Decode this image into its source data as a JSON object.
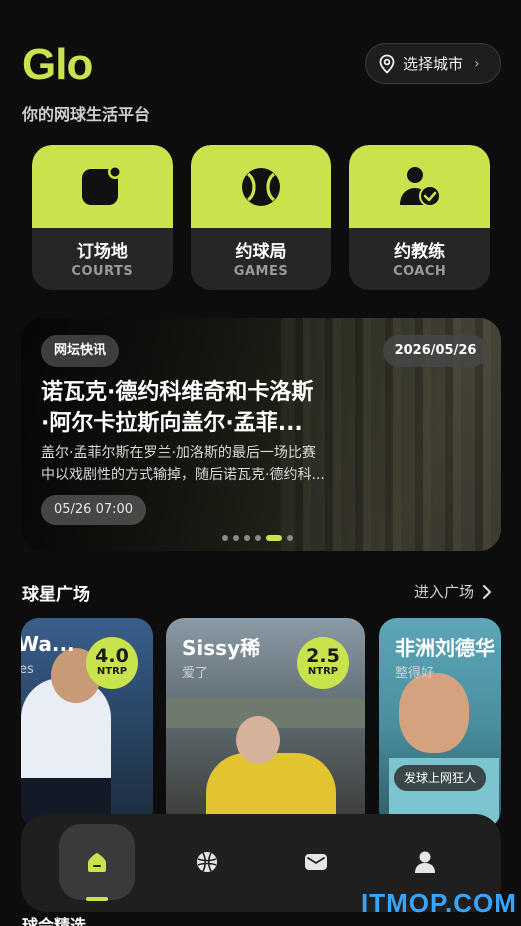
{
  "app": {
    "logo": "Glo",
    "tagline": "你的网球生活平台",
    "accent": "#c9e34c"
  },
  "city": {
    "label": "选择城市",
    "icon": "location-pin-icon"
  },
  "services": [
    {
      "cn": "订场地",
      "en": "COURTS",
      "icon": "court-icon"
    },
    {
      "cn": "约球局",
      "en": "GAMES",
      "icon": "tennis-ball-icon"
    },
    {
      "cn": "约教练",
      "en": "COACH",
      "icon": "coach-icon"
    }
  ],
  "banner": {
    "badge": "网坛快讯",
    "date": "2026/05/26",
    "headline_line1": "诺瓦克·德约科维奇和卡洛斯",
    "headline_line2": "·阿尔卡拉斯向盖尔·孟菲...",
    "summary_line1": "盖尔·孟菲尔斯在罗兰·加洛斯的最后一场比赛",
    "summary_line2": "中以戏剧性的方式输掉，随后诺瓦克·德约科...",
    "time": "05/26 07:00",
    "slide_count": 6,
    "active_slide": 5
  },
  "stars_section": {
    "title": "球星广场",
    "link": "进入广场"
  },
  "stars": [
    {
      "name": "Wa...",
      "subtitle": "es",
      "ntrp": "4.0",
      "ntrp_label": "NTRP"
    },
    {
      "name": "Sissy稀",
      "subtitle": "爱了",
      "ntrp": "2.5",
      "ntrp_label": "NTRP"
    },
    {
      "name": "非洲刘德华",
      "subtitle": "整得好",
      "tag": "发球上网狂人"
    }
  ],
  "tabs": [
    {
      "name": "home",
      "icon": "home-icon",
      "active": true
    },
    {
      "name": "explore",
      "icon": "globe-icon",
      "active": false
    },
    {
      "name": "messages",
      "icon": "mail-icon",
      "active": false
    },
    {
      "name": "profile",
      "icon": "user-icon",
      "active": false
    }
  ],
  "next_section": {
    "title": "球会精选"
  },
  "watermark": "ITMOP.COM"
}
